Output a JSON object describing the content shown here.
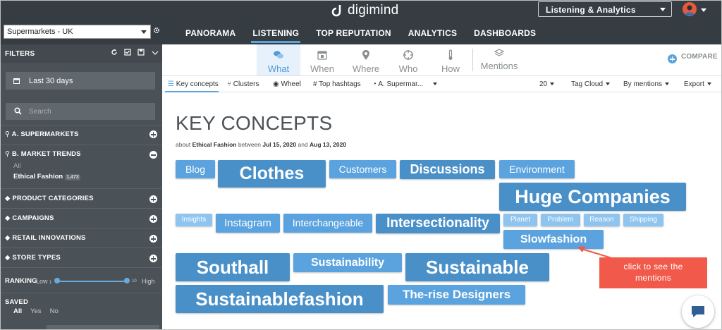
{
  "app": {
    "brand": "digimind",
    "product_select": "Listening & Analytics"
  },
  "store_select": "Supermarkets - UK",
  "nav": [
    "PANORAMA",
    "LISTENING",
    "TOP REPUTATION",
    "ANALYTICS",
    "DASHBOARDS"
  ],
  "sidebar": {
    "title": "FILTERS",
    "period": "Last 30 days",
    "search_placeholder": "Search",
    "sections": [
      "A. SUPERMARKETS",
      "B. MARKET TRENDS",
      "PRODUCT CATEGORIES",
      "CAMPAIGNS",
      "RETAIL INNOVATIONS",
      "STORE TYPES"
    ],
    "market_all": "All",
    "market_selected": "Ethical Fashion",
    "market_count": "1,473",
    "ranking": {
      "label": "RANKING",
      "low": "Low",
      "low_n": "1",
      "high_n": "10",
      "high": "High"
    },
    "saved": {
      "label": "SAVED",
      "options": [
        "All",
        "Yes",
        "No"
      ]
    }
  },
  "view_tabs": [
    "What",
    "When",
    "Where",
    "Who",
    "How",
    "Mentions"
  ],
  "compare": "COMPARE",
  "sub_tabs": [
    "Key concepts",
    "Clusters",
    "Wheel",
    "Top hashtags",
    "A. Supermar..."
  ],
  "sub_right": {
    "count": "20",
    "view": "Tag Cloud",
    "sort": "By mentions",
    "export": "Export"
  },
  "main": {
    "title": "KEY CONCEPTS",
    "about": "about",
    "topic": "Ethical Fashion",
    "between": "between",
    "date_from": "Jul 15, 2020",
    "and": "and",
    "date_to": "Aug 13, 2020"
  },
  "tags": [
    "Blog",
    "Clothes",
    "Customers",
    "Discussions",
    "Environment",
    "Huge Companies",
    "Insights",
    "Instagram",
    "Interchangeable",
    "Intersectionality",
    "Planet",
    "Problem",
    "Reason",
    "Shipping",
    "Slowfashion",
    "Southall",
    "Sustainability",
    "Sustainable",
    "Sustainablefashion",
    "The-rise Designers"
  ],
  "callout": {
    "line1": "click to  see the",
    "line2": "mentions"
  },
  "colors": {
    "tag_dark": "#4a90c8",
    "tag_mid": "#5ba3de",
    "tag_light": "#8ec4ee",
    "accent": "#5aa4dd",
    "callout": "#f15a4a",
    "sidebar": "#4b5257",
    "topbar": "#353c42"
  }
}
